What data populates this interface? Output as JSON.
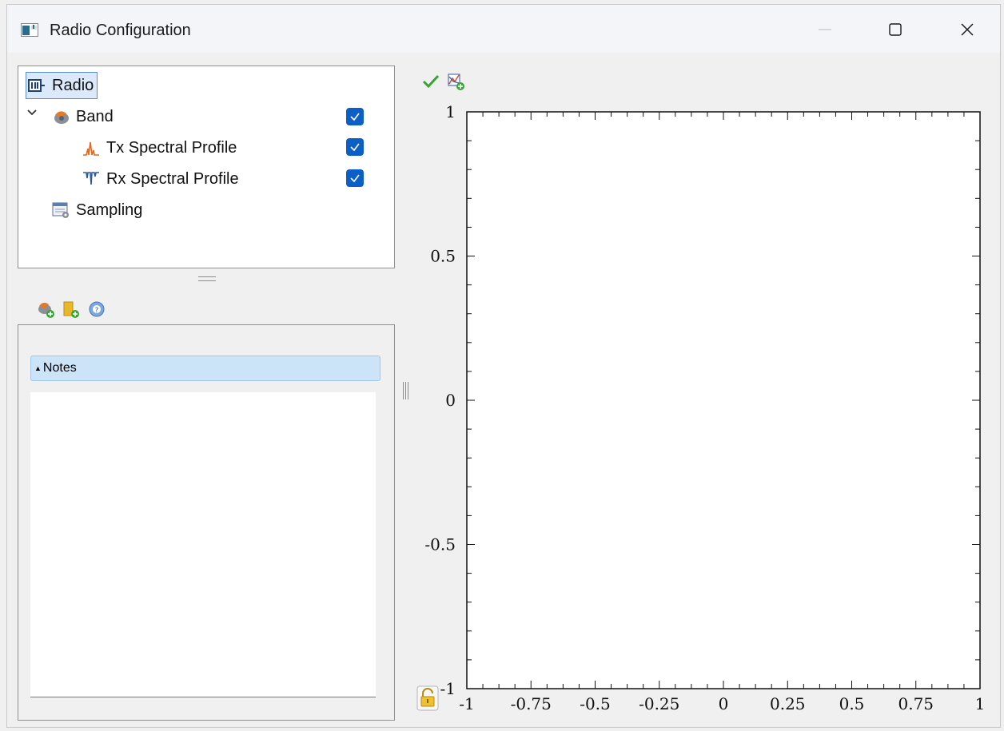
{
  "window": {
    "title": "Radio Configuration",
    "controls": {
      "minimize": "—",
      "maximize": "☐",
      "close": "✕"
    }
  },
  "tree": {
    "items": [
      {
        "label": "Radio",
        "icon": "radio-icon",
        "selected": true
      },
      {
        "label": "Band",
        "icon": "band-icon",
        "expanded": true,
        "checked": true
      },
      {
        "label": "Tx Spectral Profile",
        "icon": "tx-spectrum-icon",
        "checked": true
      },
      {
        "label": "Rx Spectral Profile",
        "icon": "rx-spectrum-icon",
        "checked": true
      },
      {
        "label": "Sampling",
        "icon": "sampling-icon"
      }
    ]
  },
  "properties_toolbar": [
    "add-band-icon",
    "add-folder-icon",
    "help-icon"
  ],
  "notes": {
    "header": "Notes",
    "text": ""
  },
  "plot_toolbar": [
    "apply-check-icon",
    "add-plot-icon"
  ],
  "chart_data": {
    "type": "line",
    "series": [],
    "xlim": [
      -1,
      1
    ],
    "ylim": [
      -1,
      1
    ],
    "x_ticks": [
      "-1",
      "-0.75",
      "-0.5",
      "-0.25",
      "0",
      "0.25",
      "0.5",
      "0.75",
      "1"
    ],
    "y_ticks": [
      "1",
      "0.5",
      "0",
      "-0.5",
      "-1"
    ],
    "grid": false
  },
  "colors": {
    "accent": "#0b5fc6",
    "selection": "#dbe9fb",
    "notes_header": "#cce4f7"
  }
}
